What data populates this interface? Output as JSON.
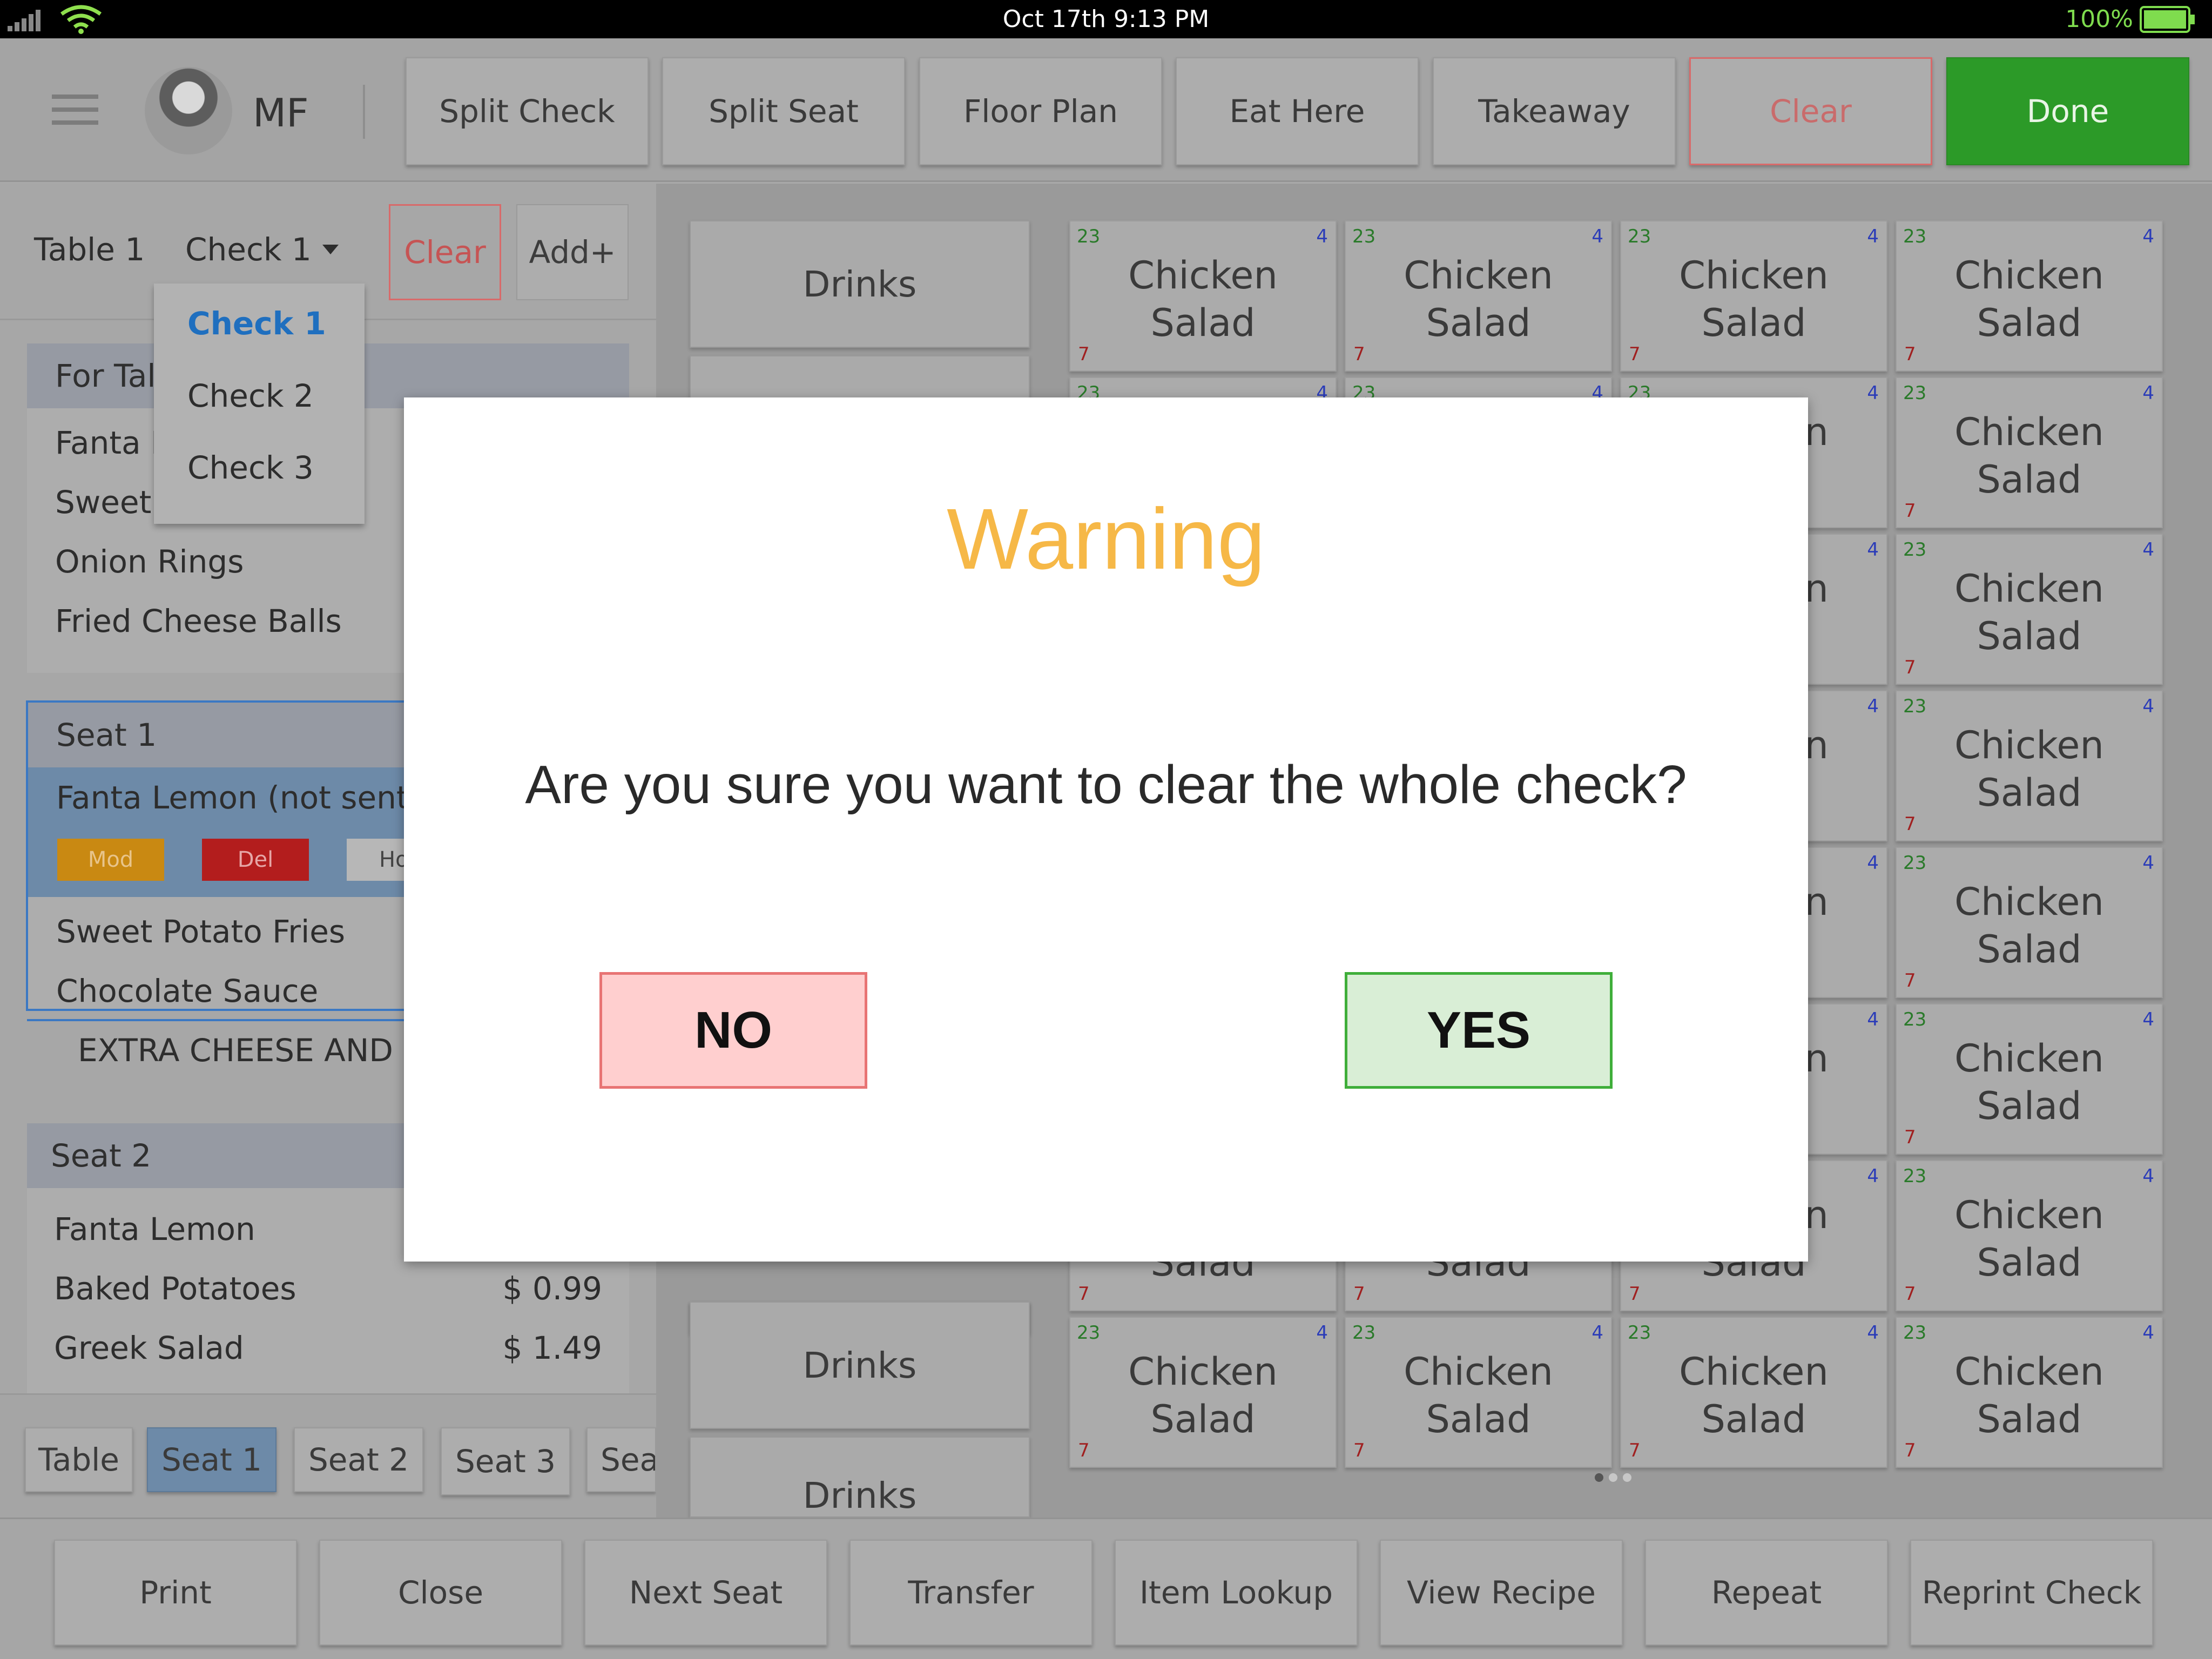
{
  "status_bar": {
    "datetime": "Oct 17th   9:13 PM",
    "battery": "100%"
  },
  "toolbar": {
    "user_initials": "MF",
    "buttons": [
      "Split Check",
      "Split Seat",
      "Floor Plan",
      "Eat Here",
      "Takeaway",
      "Clear",
      "Done"
    ]
  },
  "left": {
    "table_label": "Table 1",
    "check_label": "Check 1",
    "clear_label": "Clear",
    "add_label": "Add+",
    "for_table_head": "For Tal",
    "for_table_items": [
      "Fanta L",
      "Sweet",
      "Onion Rings",
      "Fried Cheese Balls"
    ],
    "seat1": {
      "head": "Seat 1",
      "selected_item": "Fanta Lemon (not sent)",
      "actions": [
        "Mod",
        "Del",
        "Ho"
      ],
      "items": [
        "Sweet Potato Fries",
        "Chocolate Sauce"
      ],
      "note": "EXTRA CHEESE AND L"
    },
    "seat2": {
      "head": "Seat 2",
      "items": [
        {
          "name": "Fanta Lemon",
          "price": ""
        },
        {
          "name": "Baked Potatoes",
          "price": "$ 0.99"
        },
        {
          "name": "Greek Salad",
          "price": "$ 1.49"
        }
      ]
    },
    "seat_tabs": [
      "Table",
      "Seat 1",
      "Seat 2",
      "Seat 3",
      "Sea"
    ]
  },
  "dropdown": {
    "options": [
      "Check 1",
      "Check 2",
      "Check 3"
    ]
  },
  "categories": {
    "drinks_label": "Drinks"
  },
  "menu_tile": {
    "name_line1": "Chicken",
    "name_line2": "Salad",
    "top_left": "23",
    "top_right": "4",
    "bottom_left": "7"
  },
  "modal": {
    "title": "Warning",
    "message": "Are you sure you want to clear the whole check?",
    "no_label": "NO",
    "yes_label": "YES"
  },
  "bottom_bar": {
    "buttons": [
      "Print",
      "Close",
      "Next Seat",
      "Transfer",
      "Item Lookup",
      "View Recipe",
      "Repeat",
      "Reprint Check"
    ]
  },
  "colors": {
    "done": "#2c9a28",
    "clear": "#e05a5a",
    "warning": "#f6b847",
    "link": "#1f6fbf"
  }
}
